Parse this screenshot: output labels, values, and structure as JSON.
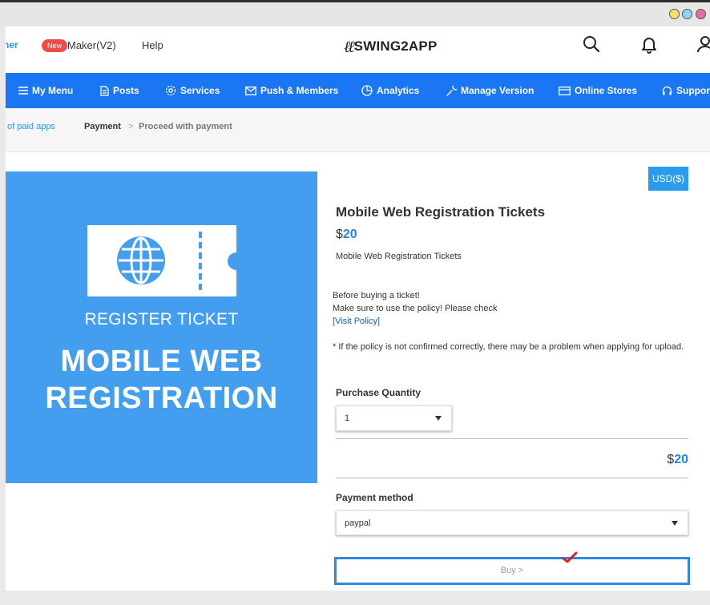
{
  "header": {
    "partial_link": "ner",
    "new_badge": "New",
    "maker": "Maker(V2)",
    "help": "Help",
    "logo_text": "SWING2APP",
    "icons": [
      "search-icon",
      "bell-icon",
      "user-icon"
    ]
  },
  "nav": {
    "items": [
      {
        "label": "My Menu",
        "icon": "hamburger-icon"
      },
      {
        "label": "Posts",
        "icon": "document-icon"
      },
      {
        "label": "Services",
        "icon": "gear-icon"
      },
      {
        "label": "Push & Members",
        "icon": "envelope-icon"
      },
      {
        "label": "Analytics",
        "icon": "pie-chart-icon"
      },
      {
        "label": "Manage Version",
        "icon": "wrench-icon"
      },
      {
        "label": "Online Stores",
        "icon": "card-icon"
      },
      {
        "label": "Suppor",
        "icon": "headset-icon"
      }
    ],
    "background": "#1a76f2"
  },
  "breadcrumb": {
    "first": "of paid apps",
    "second": "Payment",
    "separator": ">",
    "third": "Proceed with payment"
  },
  "banner": {
    "subtitle": "REGISTER TICKET",
    "title_line1": "MOBILE WEB",
    "title_line2": "REGISTRATION",
    "background": "#449ef0"
  },
  "product": {
    "currency_button": "USD($)",
    "title": "Mobile Web Registration Tickets",
    "price_symbol": "$",
    "price_value": "20",
    "description": "Mobile Web Registration Tickets",
    "notice_line1": "Before buying a ticket!",
    "notice_line2": "Make sure to use the policy! Please check",
    "policy_link": "[Visit Policy]",
    "notice_warning": "* If the policy is not confirmed correctly, there may be a problem when applying for upload."
  },
  "purchase": {
    "quantity_label": "Purchase Quantity",
    "quantity_value": "1",
    "total_symbol": "$",
    "total_value": "20",
    "payment_label": "Payment method",
    "payment_value": "paypal",
    "buy_button": "Buy >"
  },
  "colors": {
    "accent": "#1a8ae6",
    "new_badge": "#f04b4b",
    "checkmark": "#e02020"
  }
}
